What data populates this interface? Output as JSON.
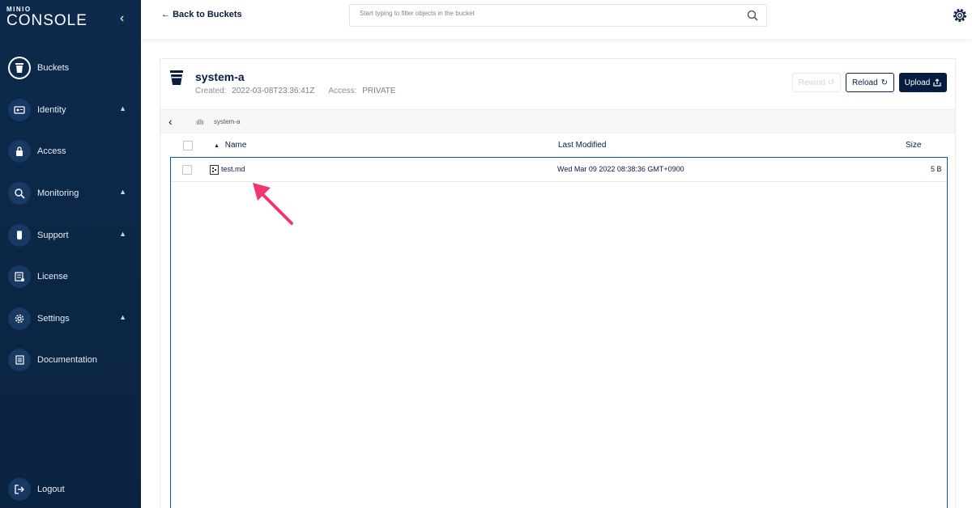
{
  "logo": {
    "top": "MINIO",
    "bottom": "CONSOLE"
  },
  "sidebar": {
    "items": [
      {
        "label": "Buckets",
        "icon": "bucket-icon",
        "active": true
      },
      {
        "label": "Identity",
        "icon": "identity-icon",
        "expandable": true
      },
      {
        "label": "Access",
        "icon": "lock-icon"
      },
      {
        "label": "Monitoring",
        "icon": "monitoring-icon",
        "expandable": true
      },
      {
        "label": "Support",
        "icon": "support-icon",
        "expandable": true
      },
      {
        "label": "License",
        "icon": "license-icon"
      },
      {
        "label": "Settings",
        "icon": "gear-icon",
        "expandable": true
      },
      {
        "label": "Documentation",
        "icon": "documentation-icon"
      }
    ],
    "logout": "Logout"
  },
  "header": {
    "back": "Back to Buckets",
    "search_placeholder": "Start typing to filter objects in the bucket"
  },
  "bucket": {
    "name": "system-a",
    "created_label": "Created:",
    "created": "2022-03-08T23:36:41Z",
    "access_label": "Access:",
    "access": "PRIVATE"
  },
  "buttons": {
    "rewind": "Rewind",
    "reload": "Reload",
    "upload": "Upload"
  },
  "breadcrumb": {
    "path": "system-a"
  },
  "table": {
    "headers": {
      "name": "Name",
      "modified": "Last Modified",
      "size": "Size"
    },
    "rows": [
      {
        "name": "test.md",
        "modified": "Wed Mar 09 2022 08:38:36 GMT+0900",
        "size": "5 B"
      }
    ]
  },
  "colors": {
    "sidebar": "#0d2a4c",
    "primary": "#081c42",
    "selection": "#0a57b4",
    "arrow": "#f2366e"
  }
}
